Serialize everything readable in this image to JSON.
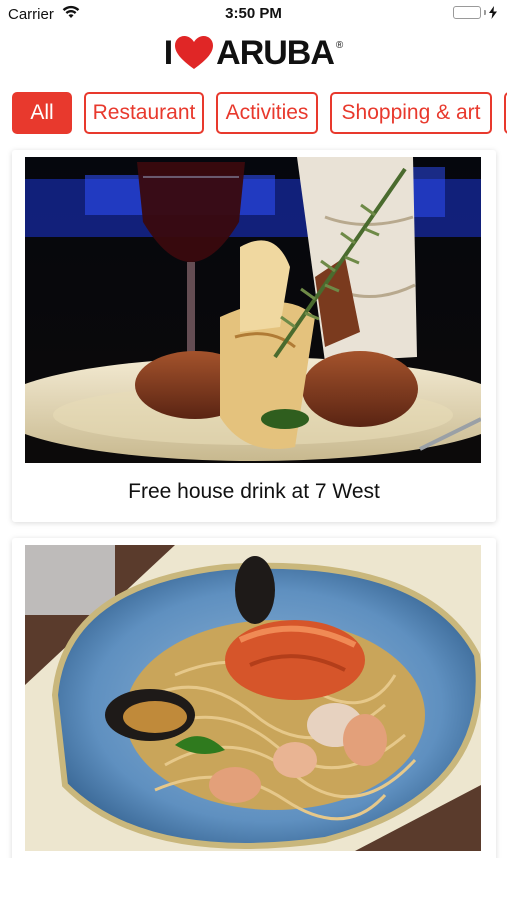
{
  "status_bar": {
    "carrier": "Carrier",
    "time": "3:50 PM",
    "icons": [
      "wifi-icon",
      "battery-icon",
      "charging-icon"
    ]
  },
  "logo": {
    "i": "I",
    "text": "ARUBA",
    "reg": "®"
  },
  "tabs": [
    "All",
    "Restaurant",
    "Activities",
    "Shopping & art",
    ""
  ],
  "cards": [
    {
      "title": "Free house drink at 7 West",
      "image": "plated-lamb-chops-with-rosemary-and-wine"
    },
    {
      "title": "",
      "image": "seafood-pasta-with-lobster-in-blue-bowl"
    }
  ],
  "colors": {
    "accent": "#e8392d",
    "heart": "#e02626",
    "battery": "#4cd964"
  }
}
